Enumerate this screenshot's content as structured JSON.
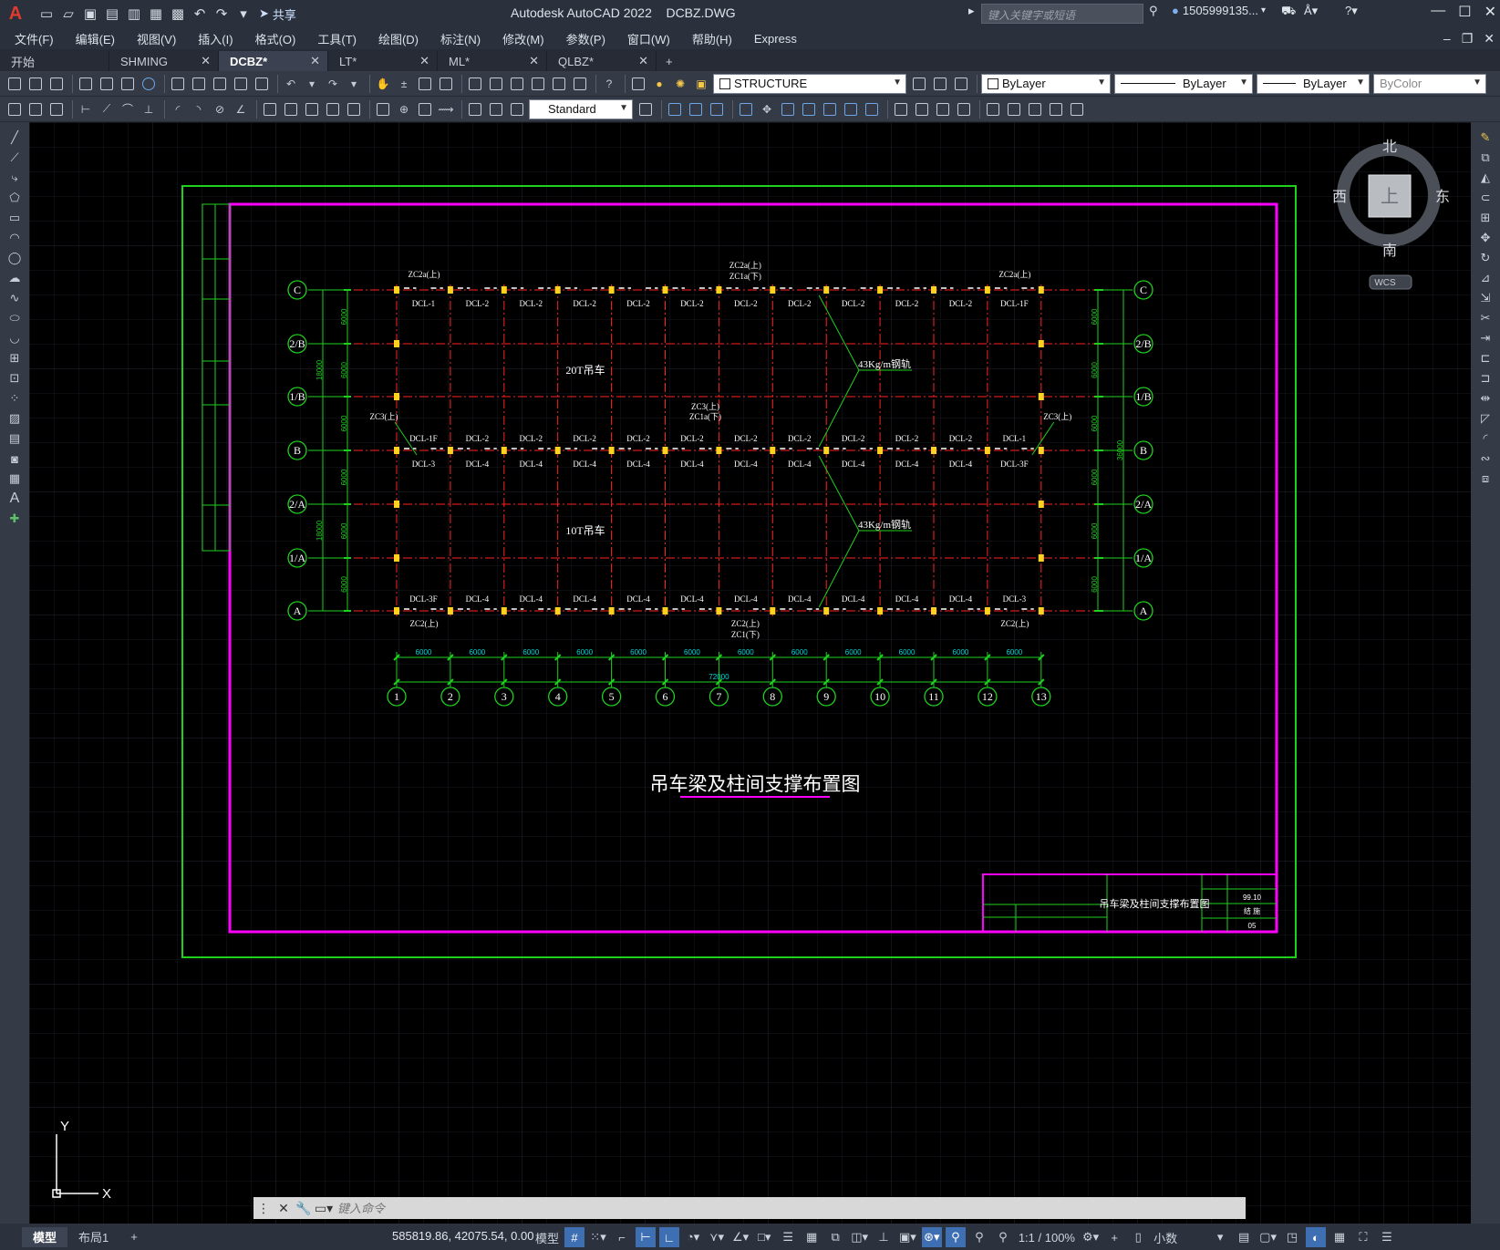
{
  "app": {
    "title": "Autodesk AutoCAD 2022",
    "filename": "DCBZ.DWG",
    "logo": "A",
    "share_label": "共享",
    "search_placeholder": "键入关键字或短语",
    "user": "1505999135..."
  },
  "menu": [
    "文件(F)",
    "编辑(E)",
    "视图(V)",
    "插入(I)",
    "格式(O)",
    "工具(T)",
    "绘图(D)",
    "标注(N)",
    "修改(M)",
    "参数(P)",
    "窗口(W)",
    "帮助(H)",
    "Express"
  ],
  "tabs": [
    {
      "label": "开始",
      "active": false,
      "closable": false
    },
    {
      "label": "SHMING",
      "active": false,
      "closable": true
    },
    {
      "label": "DCBZ*",
      "active": true,
      "closable": true
    },
    {
      "label": "LT*",
      "active": false,
      "closable": true
    },
    {
      "label": "ML*",
      "active": false,
      "closable": true
    },
    {
      "label": "QLBZ*",
      "active": false,
      "closable": true
    }
  ],
  "properties": {
    "layer": "STRUCTURE",
    "color": "ByLayer",
    "linetype": "ByLayer",
    "lineweight": "ByLayer",
    "plotstyle": "ByColor",
    "textstyle": "Standard"
  },
  "viewcube": {
    "north": "北",
    "south": "南",
    "east": "东",
    "west": "西",
    "face": "上",
    "wcs": "WCS"
  },
  "drawing": {
    "title": "吊车梁及柱间支撑布置图",
    "crane_top": "20T吊车",
    "crane_bottom": "10T吊车",
    "rail_label": "43Kg/m钢轨",
    "row_axes": [
      "C",
      "2/B",
      "1/B",
      "B",
      "2/A",
      "1/A",
      "A"
    ],
    "col_axes": [
      "1",
      "2",
      "3",
      "4",
      "5",
      "6",
      "7",
      "8",
      "9",
      "10",
      "11",
      "12",
      "13"
    ],
    "bay_dims": [
      "6000",
      "6000",
      "6000",
      "6000",
      "6000",
      "6000",
      "6000",
      "6000",
      "6000",
      "6000",
      "6000",
      "6000"
    ],
    "total_dim": "72000",
    "row_dims_left": [
      "6000",
      "6000",
      "6000",
      "6000",
      "6000",
      "6000"
    ],
    "span_dims": [
      "18000",
      "18000"
    ],
    "right_total": "36000",
    "row_C_beams": [
      "DCL-1",
      "DCL-2",
      "DCL-2",
      "DCL-2",
      "DCL-2",
      "DCL-2",
      "DCL-2",
      "DCL-2",
      "DCL-2",
      "DCL-2",
      "DCL-2",
      "DCL-1F"
    ],
    "row_B_upper_beams": [
      "DCL-1F",
      "DCL-2",
      "DCL-2",
      "DCL-2",
      "DCL-2",
      "DCL-2",
      "DCL-2",
      "DCL-2",
      "DCL-2",
      "DCL-2",
      "DCL-2",
      "DCL-1"
    ],
    "row_B_lower_beams": [
      "DCL-3",
      "DCL-4",
      "DCL-4",
      "DCL-4",
      "DCL-4",
      "DCL-4",
      "DCL-4",
      "DCL-4",
      "DCL-4",
      "DCL-4",
      "DCL-4",
      "DCL-3F"
    ],
    "row_A_beams": [
      "DCL-3F",
      "DCL-4",
      "DCL-4",
      "DCL-4",
      "DCL-4",
      "DCL-4",
      "DCL-4",
      "DCL-4",
      "DCL-4",
      "DCL-4",
      "DCL-4",
      "DCL-3"
    ],
    "braces": {
      "c_left": "ZC2a(上)",
      "c_mid_1": "ZC2a(上)",
      "c_mid_2": "ZC1a(下)",
      "c_right": "ZC2a(上)",
      "b_left": "ZC3(上)",
      "b_mid_1": "ZC3(上)",
      "b_mid_2": "ZC1a(下)",
      "b_right": "ZC3(上)",
      "a_left": "ZC2(上)",
      "a_mid_1": "ZC2(上)",
      "a_mid_2": "ZC1(下)",
      "a_right": "ZC2(上)"
    },
    "titleblock": {
      "name": "吊车梁及柱间支撑布置图",
      "date": "99.10",
      "sheet": "05",
      "scale": "结 施"
    }
  },
  "ucs": {
    "x": "X",
    "y": "Y"
  },
  "command": {
    "placeholder": "键入命令"
  },
  "layout_tabs": [
    "模型",
    "布局1"
  ],
  "status": {
    "coords": "585819.86, 42075.54, 0.00",
    "mode": "模型",
    "scale": "1:1 / 100%",
    "units": "小数"
  }
}
